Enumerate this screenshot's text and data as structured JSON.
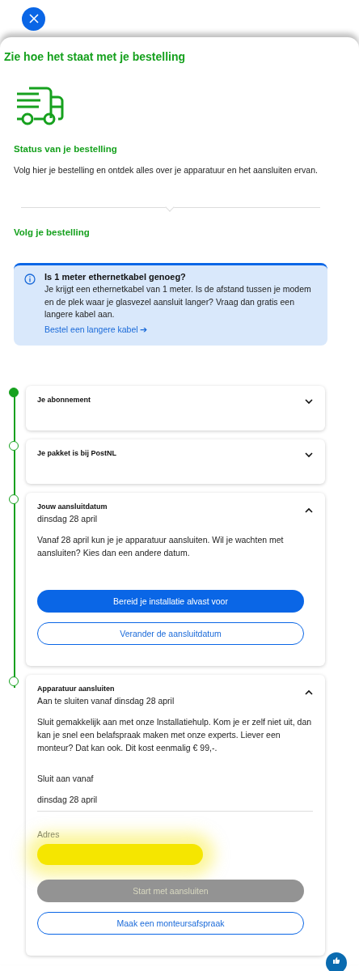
{
  "title": "Zie hoe het staat met je bestelling",
  "status": {
    "heading": "Status van je bestelling",
    "text": "Volg hier je bestelling en ontdek alles over je apparatuur en het aansluiten ervan."
  },
  "track_heading": "Volg je bestelling",
  "notice": {
    "title": "Is 1 meter ethernetkabel genoeg?",
    "text": "Je krijgt een ethernetkabel van 1 meter. Is de afstand tussen je modem en de plek waar je glasvezel aansluit langer? Vraag dan gratis een langere kabel aan.",
    "link": "Bestel een langere kabel",
    "link_arrow": "➔"
  },
  "steps": [
    {
      "title": "Je abonnement",
      "done": true,
      "expanded": false
    },
    {
      "title": "Je pakket is bij PostNL",
      "done": false,
      "expanded": false
    },
    {
      "title": "Jouw aansluitdatum",
      "subtitle": "dinsdag 28 april",
      "done": false,
      "expanded": true,
      "text": "Vanaf 28 april kun je je apparatuur aansluiten. Wil je wachten met aansluiten? Kies dan een andere datum.",
      "buttons": [
        {
          "label": "Bereid je installatie alvast voor",
          "kind": "primary",
          "disabled": false
        },
        {
          "label": "Verander de aansluitdatum",
          "kind": "outline",
          "disabled": false
        }
      ]
    },
    {
      "title": "Apparatuur aansluiten",
      "subtitle": "Aan te sluiten vanaf dinsdag 28 april",
      "done": false,
      "expanded": true,
      "text": "Sluit gemakkelijk aan met onze Installatiehulp. Kom je er zelf niet uit, dan kan je snel een belafspraak maken met onze experts. Liever een monteur? Dat kan ook. Dit kost eenmalig € 99,-.",
      "fields": [
        {
          "label": "Sluit aan vanaf",
          "value": "dinsdag 28 april"
        },
        {
          "label": "Adres",
          "redacted": true
        }
      ],
      "buttons": [
        {
          "label": "Start met aansluiten",
          "kind": "primary",
          "disabled": true
        },
        {
          "label": "Maak een monteursafspraak",
          "kind": "outline",
          "disabled": false
        }
      ]
    }
  ]
}
